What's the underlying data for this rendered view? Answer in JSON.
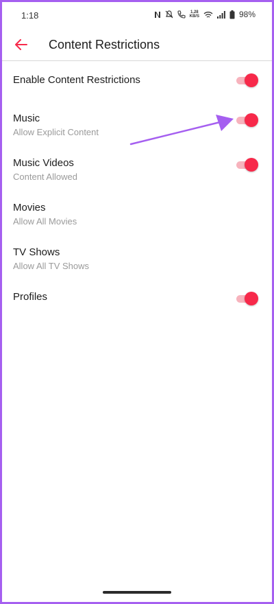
{
  "status_bar": {
    "time": "1:18",
    "net_speed_top": "1.28",
    "net_speed_bottom": "KB/S",
    "battery_percent": "98%"
  },
  "header": {
    "title": "Content Restrictions",
    "back_icon": "arrow-left-icon"
  },
  "settings": [
    {
      "label": "Enable Content Restrictions",
      "subtitle": "",
      "toggle": true,
      "toggle_on": true
    },
    {
      "label": "Music",
      "subtitle": "Allow Explicit Content",
      "toggle": true,
      "toggle_on": true
    },
    {
      "label": "Music Videos",
      "subtitle": "Content Allowed",
      "toggle": true,
      "toggle_on": true
    },
    {
      "label": "Movies",
      "subtitle": "Allow All Movies",
      "toggle": false
    },
    {
      "label": "TV Shows",
      "subtitle": "Allow All TV Shows",
      "toggle": false
    },
    {
      "label": "Profiles",
      "subtitle": "",
      "toggle": true,
      "toggle_on": true
    }
  ],
  "colors": {
    "accent": "#f7294a",
    "accent_track": "#f7b3bd",
    "annotation": "#a55ff0",
    "frame": "#a55ff0"
  }
}
